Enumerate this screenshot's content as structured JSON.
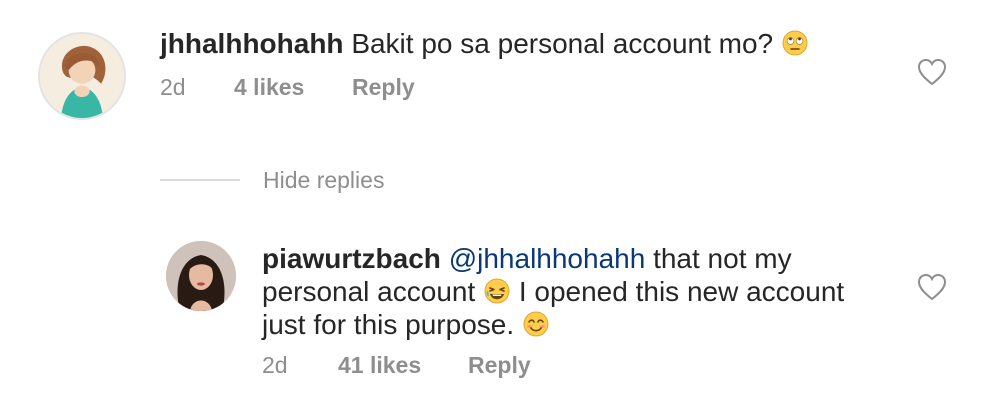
{
  "comment1": {
    "username": "jhhalhhohahh",
    "text": "Bakit po sa personal account mo?",
    "emoji": "face-with-rolling-eyes-icon",
    "time": "2d",
    "likes": "4 likes",
    "reply_label": "Reply"
  },
  "replies_toggle": {
    "label": "Hide replies"
  },
  "reply1": {
    "username": "piawurtzbach",
    "mention": "@jhhalhhohahh",
    "text_part1": "that not my personal account",
    "emoji1": "laughing-face-icon",
    "text_part2": "I opened this new account just for this purpose.",
    "emoji2": "smiling-face-icon",
    "time": "2d",
    "likes": "41 likes",
    "reply_label": "Reply"
  },
  "colors": {
    "text": "#262626",
    "muted": "#8e8e8e",
    "mention": "#0a3874",
    "divider": "#dbdbdb"
  }
}
